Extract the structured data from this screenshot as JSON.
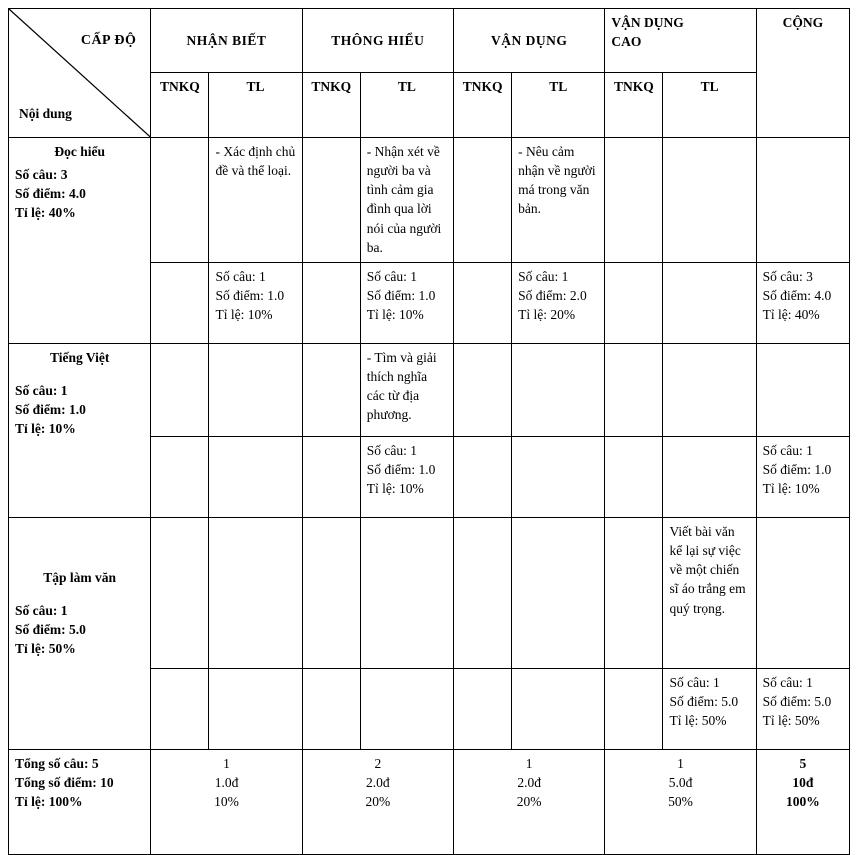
{
  "table": {
    "corner": {
      "level_label": "CẤP ĐỘ",
      "content_label": "Nội dung"
    },
    "levels": [
      {
        "name": "NHẬN BIẾT"
      },
      {
        "name": "THÔNG HIỂU"
      },
      {
        "name": "VẬN DỤNG"
      },
      {
        "name": "VẬN DỤNG CAO"
      }
    ],
    "level_vdc_line1": "VẬN DỤNG",
    "level_vdc_line2": "CAO",
    "total_col_header": "CỘNG",
    "sub_headers": {
      "tnkq": "TNKQ",
      "tl": "TL"
    },
    "rows": [
      {
        "label_title": "Đọc hiểu",
        "label_lines": [
          "Số câu: 3",
          "Số điểm: 4.0",
          "Tỉ lệ: 40%"
        ],
        "content": {
          "nb_tnkq": "",
          "nb_tl": "- Xác định chủ đề và thể loại.",
          "th_tnkq": "",
          "th_tl": "- Nhận xét về người ba và tình cảm gia đình qua lời nói của người ba.",
          "vd_tnkq": "",
          "vd_tl": "- Nêu cảm nhận về người má trong văn bản.",
          "vdc_tnkq": "",
          "vdc_tl": ""
        },
        "stats": {
          "nb_tnkq": [],
          "nb_tl": [
            "Số câu: 1",
            "Số điểm: 1.0",
            "Tỉ lệ: 10%"
          ],
          "th_tnkq": [],
          "th_tl": [
            "Số câu: 1",
            "Số điểm: 1.0",
            "Tỉ lệ: 10%"
          ],
          "vd_tnkq": [],
          "vd_tl": [
            "Số câu: 1",
            "Số điểm: 2.0",
            "Tỉ lệ: 20%"
          ],
          "vdc_tnkq": [],
          "vdc_tl": [],
          "cong": [
            "Số câu: 3",
            "Số điểm: 4.0",
            "Tỉ lệ: 40%"
          ]
        }
      },
      {
        "label_title": "Tiếng Việt",
        "label_lines": [
          "Số câu: 1",
          "Số điểm: 1.0",
          "Tỉ lệ: 10%"
        ],
        "content": {
          "nb_tnkq": "",
          "nb_tl": "",
          "th_tnkq": "",
          "th_tl": "- Tìm và giải thích nghĩa các từ địa phương.",
          "vd_tnkq": "",
          "vd_tl": "",
          "vdc_tnkq": "",
          "vdc_tl": ""
        },
        "stats": {
          "nb_tnkq": [],
          "nb_tl": [],
          "th_tnkq": [],
          "th_tl": [
            "Số câu: 1",
            "Số điểm: 1.0",
            "Tỉ lệ: 10%"
          ],
          "vd_tnkq": [],
          "vd_tl": [],
          "vdc_tnkq": [],
          "vdc_tl": [],
          "cong": [
            "Số câu: 1",
            "Số điểm: 1.0",
            "Tỉ lệ: 10%"
          ]
        }
      },
      {
        "label_title": "Tập làm văn",
        "label_lines": [
          "Số câu: 1",
          "Số điểm: 5.0",
          "Tỉ lệ: 50%"
        ],
        "content": {
          "nb_tnkq": "",
          "nb_tl": "",
          "th_tnkq": "",
          "th_tl": "",
          "vd_tnkq": "",
          "vd_tl": "",
          "vdc_tnkq": "",
          "vdc_tl": "Viết bài văn kể lại sự việc về một chiến sĩ áo trắng em quý trọng."
        },
        "stats": {
          "nb_tnkq": [],
          "nb_tl": [],
          "th_tnkq": [],
          "th_tl": [],
          "vd_tnkq": [],
          "vd_tl": [],
          "vdc_tnkq": [],
          "vdc_tl": [
            "Số câu: 1",
            "Số điểm: 5.0",
            "Tỉ lệ: 50%"
          ],
          "cong": [
            "Số câu: 1",
            "Số điểm: 5.0",
            "Tỉ lệ: 50%"
          ]
        }
      }
    ],
    "totals": {
      "labels": [
        "Tổng số câu: 5",
        "Tổng số điểm: 10",
        "Tỉ lệ: 100%"
      ],
      "columns": [
        {
          "count": "1",
          "score": "1.0đ",
          "percent": "10%"
        },
        {
          "count": "2",
          "score": "2.0đ",
          "percent": "20%"
        },
        {
          "count": "1",
          "score": "2.0đ",
          "percent": "20%"
        },
        {
          "count": "1",
          "score": "5.0đ",
          "percent": "50%"
        }
      ],
      "total": {
        "count": "5",
        "score": "10đ",
        "percent": "100%"
      }
    }
  }
}
